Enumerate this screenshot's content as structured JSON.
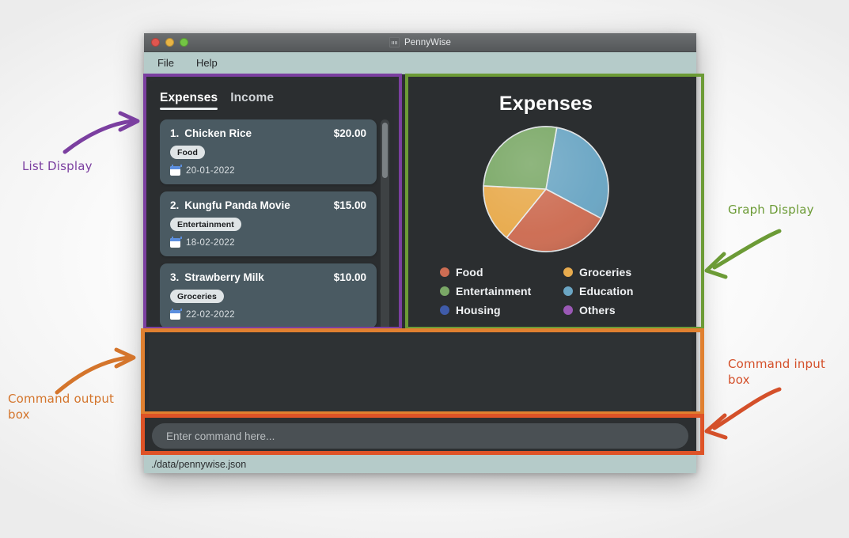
{
  "window": {
    "title": "PennyWise",
    "app_icon": "chart-app-icon",
    "traffic_lights": [
      "close-button",
      "minimize-button",
      "maximize-button"
    ],
    "colors": {
      "close": "#e0564f",
      "minimize": "#e8b445",
      "maximize": "#73c544",
      "menubar_bg": "#b5cbc9",
      "panel_bg": "#2b2e30",
      "card_bg": "#4a5a62"
    }
  },
  "menubar": {
    "items": [
      {
        "label": "File",
        "name": "menu-file"
      },
      {
        "label": "Help",
        "name": "menu-help"
      }
    ]
  },
  "list_panel": {
    "tabs": [
      {
        "label": "Expenses",
        "active": true
      },
      {
        "label": "Income",
        "active": false
      }
    ],
    "items": [
      {
        "index": "1.",
        "name": "Chicken Rice",
        "amount": "$20.00",
        "tag": "Food",
        "date": "20-01-2022"
      },
      {
        "index": "2.",
        "name": "Kungfu Panda Movie",
        "amount": "$15.00",
        "tag": "Entertainment",
        "date": "18-02-2022"
      },
      {
        "index": "3.",
        "name": "Strawberry Milk",
        "amount": "$10.00",
        "tag": "Groceries",
        "date": "22-02-2022"
      }
    ]
  },
  "graph_panel": {
    "title": "Expenses"
  },
  "chart_data": {
    "type": "pie",
    "title": "Expenses",
    "legend_position": "bottom",
    "categories": [
      "Food",
      "Groceries",
      "Entertainment",
      "Education",
      "Housing",
      "Others"
    ],
    "values": [
      28,
      15,
      27,
      30,
      0,
      0
    ],
    "colors": [
      "#cd6d53",
      "#e8ab4e",
      "#7aa866",
      "#6ba6c4",
      "#3f5ba9",
      "#9b59b6"
    ],
    "slices": [
      {
        "label": "Education",
        "percent": 30,
        "color": "#6ba6c4",
        "start_deg": 10,
        "end_deg": 118
      },
      {
        "label": "Food",
        "percent": 28,
        "color": "#cd6d53",
        "start_deg": 118,
        "end_deg": 219
      },
      {
        "label": "Groceries",
        "percent": 15,
        "color": "#e8ab4e",
        "start_deg": 219,
        "end_deg": 273
      },
      {
        "label": "Entertainment",
        "percent": 27,
        "color": "#7aa866",
        "start_deg": 273,
        "end_deg": 370
      }
    ],
    "xlabel": "",
    "ylabel": ""
  },
  "command": {
    "output_text": "",
    "input_value": "",
    "input_placeholder": "Enter command here..."
  },
  "statusbar": {
    "path": "./data/pennywise.json"
  },
  "annotations": [
    {
      "label": "List Display",
      "color": "#7b3fa0",
      "name": "annotation-list-display"
    },
    {
      "label": "Graph Display",
      "color": "#6c9b36",
      "name": "annotation-graph-display"
    },
    {
      "label": "Command output\nbox",
      "color": "#d4752c",
      "name": "annotation-command-output"
    },
    {
      "label": "Command input\nbox",
      "color": "#d4502a",
      "name": "annotation-command-input"
    }
  ]
}
